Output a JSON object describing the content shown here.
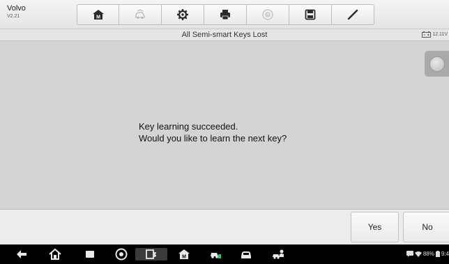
{
  "header": {
    "brand": "Volvo",
    "version": "V2.21",
    "toolbar": [
      {
        "icon": "home-icon"
      },
      {
        "icon": "vehicle-swap-icon"
      },
      {
        "icon": "settings-icon"
      },
      {
        "icon": "print-icon"
      },
      {
        "icon": "help-icon"
      },
      {
        "icon": "save-icon"
      },
      {
        "icon": "edit-icon"
      }
    ]
  },
  "titlebar": {
    "title": "All Semi-smart Keys Lost",
    "battery_voltage": "12.11V"
  },
  "main": {
    "message_line1": "Key learning succeeded.",
    "message_line2": "Would you like to learn the next key?"
  },
  "actions": {
    "yes_label": "Yes",
    "no_label": "No"
  },
  "statusbar": {
    "battery_percent": "88%",
    "time": "9:4"
  },
  "colors": {
    "nav_background": "#000000",
    "panel_background": "#d4d4d4"
  }
}
